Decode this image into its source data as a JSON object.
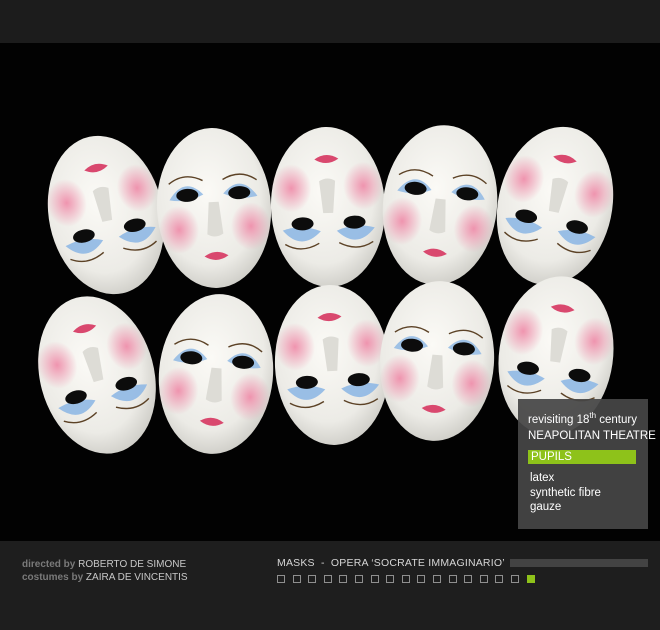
{
  "info": {
    "line1_prefix": "revisiting 18",
    "line1_sup": "th",
    "line1_suffix": " century",
    "line2": "NEAPOLITAN THEATRE",
    "highlight": "PUPILS",
    "materials": [
      "latex",
      "synthetic fibre",
      "gauze"
    ],
    "accent_color": "#8ec21a"
  },
  "footer": {
    "credit1_role": "directed by",
    "credit1_name": "ROBERTO DE SIMONE",
    "credit2_role": "costumes by",
    "credit2_name": "ZAIRA DE VINCENTIS",
    "gallery_title": "MASKS  -  OPERA ‘SOCRATE IMMAGINARIO’",
    "thumbnail_count": 17,
    "active_thumbnail": 17
  },
  "image": {
    "subject": "ten white theatre masks with pink cheeks and blue eyelids on black background"
  }
}
